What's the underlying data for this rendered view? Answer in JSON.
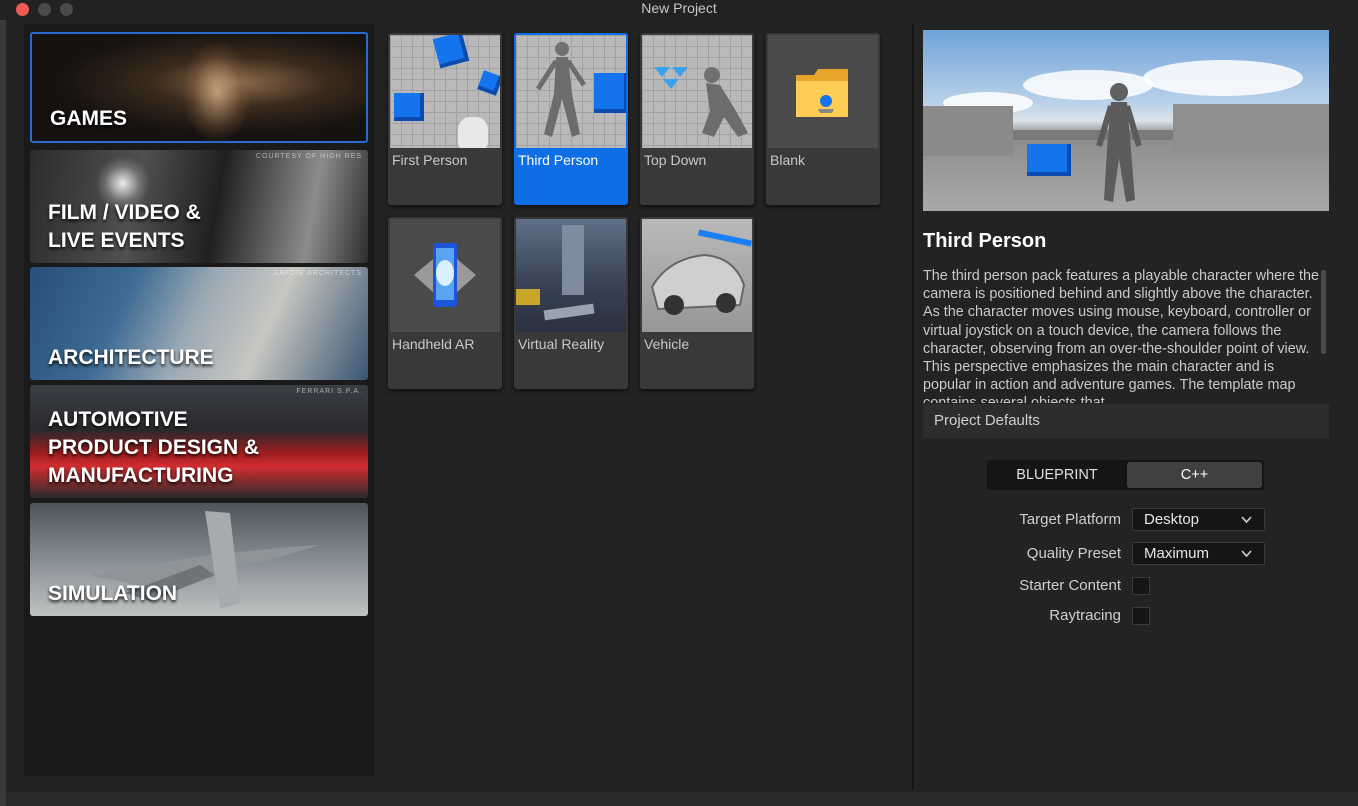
{
  "window": {
    "title": "New Project"
  },
  "categories": [
    {
      "label_line1": "GAMES",
      "label_line2": "",
      "label_line3": "",
      "credit": ""
    },
    {
      "label_line1": "FILM / VIDEO &",
      "label_line2": "LIVE EVENTS",
      "label_line3": "",
      "credit": "COURTESY OF HIGH RES"
    },
    {
      "label_line1": "ARCHITECTURE",
      "label_line2": "",
      "label_line3": "",
      "credit": "SAFDIE ARCHITECTS"
    },
    {
      "label_line1": "AUTOMOTIVE",
      "label_line2": "PRODUCT DESIGN &",
      "label_line3": "MANUFACTURING",
      "credit": "FERRARI S.P.A."
    },
    {
      "label_line1": "SIMULATION",
      "label_line2": "",
      "label_line3": "",
      "credit": ""
    }
  ],
  "selected_category": "GAMES",
  "templates": [
    {
      "label": "First Person"
    },
    {
      "label": "Third Person"
    },
    {
      "label": "Top Down"
    },
    {
      "label": "Blank"
    },
    {
      "label": "Handheld AR"
    },
    {
      "label": "Virtual Reality"
    },
    {
      "label": "Vehicle"
    }
  ],
  "selected_template": "Third Person",
  "details": {
    "title": "Third Person",
    "description": "The third person pack features a playable character where the camera is positioned behind and slightly above the character. As the character moves using mouse, keyboard, controller or virtual joystick on a touch device, the camera follows the character, observing from an over-the-shoulder point of view. This perspective emphasizes the main character and is popular in action and adventure games. The template map contains several objects that"
  },
  "project_defaults": {
    "header": "Project Defaults",
    "mode_blueprint": "BLUEPRINT",
    "mode_cpp": "C++",
    "selected_mode": "C++",
    "target_platform_label": "Target Platform",
    "target_platform_value": "Desktop",
    "quality_preset_label": "Quality Preset",
    "quality_preset_value": "Maximum",
    "starter_content_label": "Starter Content",
    "starter_content_checked": false,
    "raytracing_label": "Raytracing",
    "raytracing_checked": false
  },
  "colors": {
    "accent": "#0e6ee6",
    "cube_blue": "#1474ee",
    "close_button": "#ee5b55"
  },
  "icons": [
    "close-window-icon",
    "minimize-window-icon",
    "zoom-window-icon",
    "chevron-down-icon",
    "folder-icon",
    "phone-ar-icon"
  ]
}
